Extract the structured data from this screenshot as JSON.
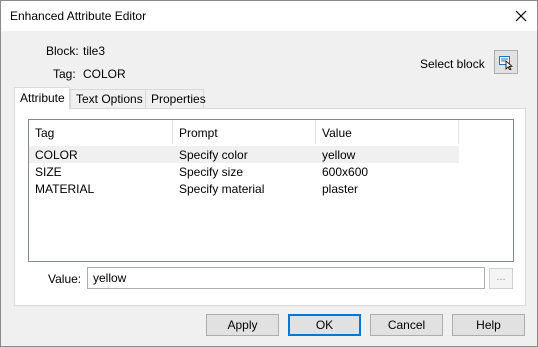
{
  "window": {
    "title": "Enhanced Attribute Editor"
  },
  "block": {
    "label": "Block:",
    "value": "tile3"
  },
  "tag": {
    "label": "Tag:",
    "value": "COLOR"
  },
  "select_block": {
    "label": "Select block",
    "icon": "select-block-icon"
  },
  "tabs": [
    {
      "label": "Attribute",
      "active": true
    },
    {
      "label": "Text Options",
      "active": false
    },
    {
      "label": "Properties",
      "active": false
    }
  ],
  "table": {
    "columns": [
      "Tag",
      "Prompt",
      "Value"
    ],
    "rows": [
      {
        "tag": "COLOR",
        "prompt": "Specify color",
        "value": "yellow",
        "selected": true
      },
      {
        "tag": "SIZE",
        "prompt": "Specify size",
        "value": "600x600",
        "selected": false
      },
      {
        "tag": "MATERIAL",
        "prompt": "Specify material",
        "value": "plaster",
        "selected": false
      }
    ]
  },
  "value_field": {
    "label": "Value:",
    "value": "yellow",
    "browse_label": "..."
  },
  "buttons": {
    "apply": "Apply",
    "ok": "OK",
    "cancel": "Cancel",
    "help": "Help"
  },
  "colors": {
    "default_button_border": "#0078d7",
    "selected_row": "#f0f0f0"
  }
}
